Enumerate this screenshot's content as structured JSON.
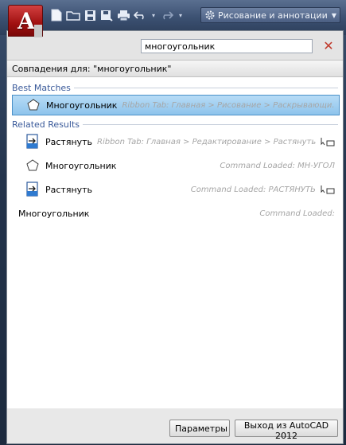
{
  "workspace": {
    "label": "Рисование и аннотации"
  },
  "search": {
    "value": "многоугольник"
  },
  "results_header": "Совпадения для: \"многоугольник\"",
  "sections": {
    "best": "Best Matches",
    "related": "Related Results"
  },
  "rows": [
    {
      "name": "Многоугольник",
      "path": "Ribbon Tab: Главная > Рисование > Раскрывающи..."
    },
    {
      "name": "Растянуть",
      "path": "Ribbon Tab: Главная > Редактирование > Растянуть"
    },
    {
      "name": "Многоугольник",
      "path": "Command Loaded: МН-УГОЛ"
    },
    {
      "name": "Растянуть",
      "path": "Command Loaded: РАСТЯНУТЬ"
    },
    {
      "name": "Многоугольник",
      "path": "Command Loaded:"
    }
  ],
  "buttons": {
    "options": "Параметры",
    "exit": "Выход из AutoCAD 2012"
  },
  "colors": {
    "accent": "#a01010",
    "selection": "#8ec4ec",
    "section_text": "#3a5a9a"
  }
}
